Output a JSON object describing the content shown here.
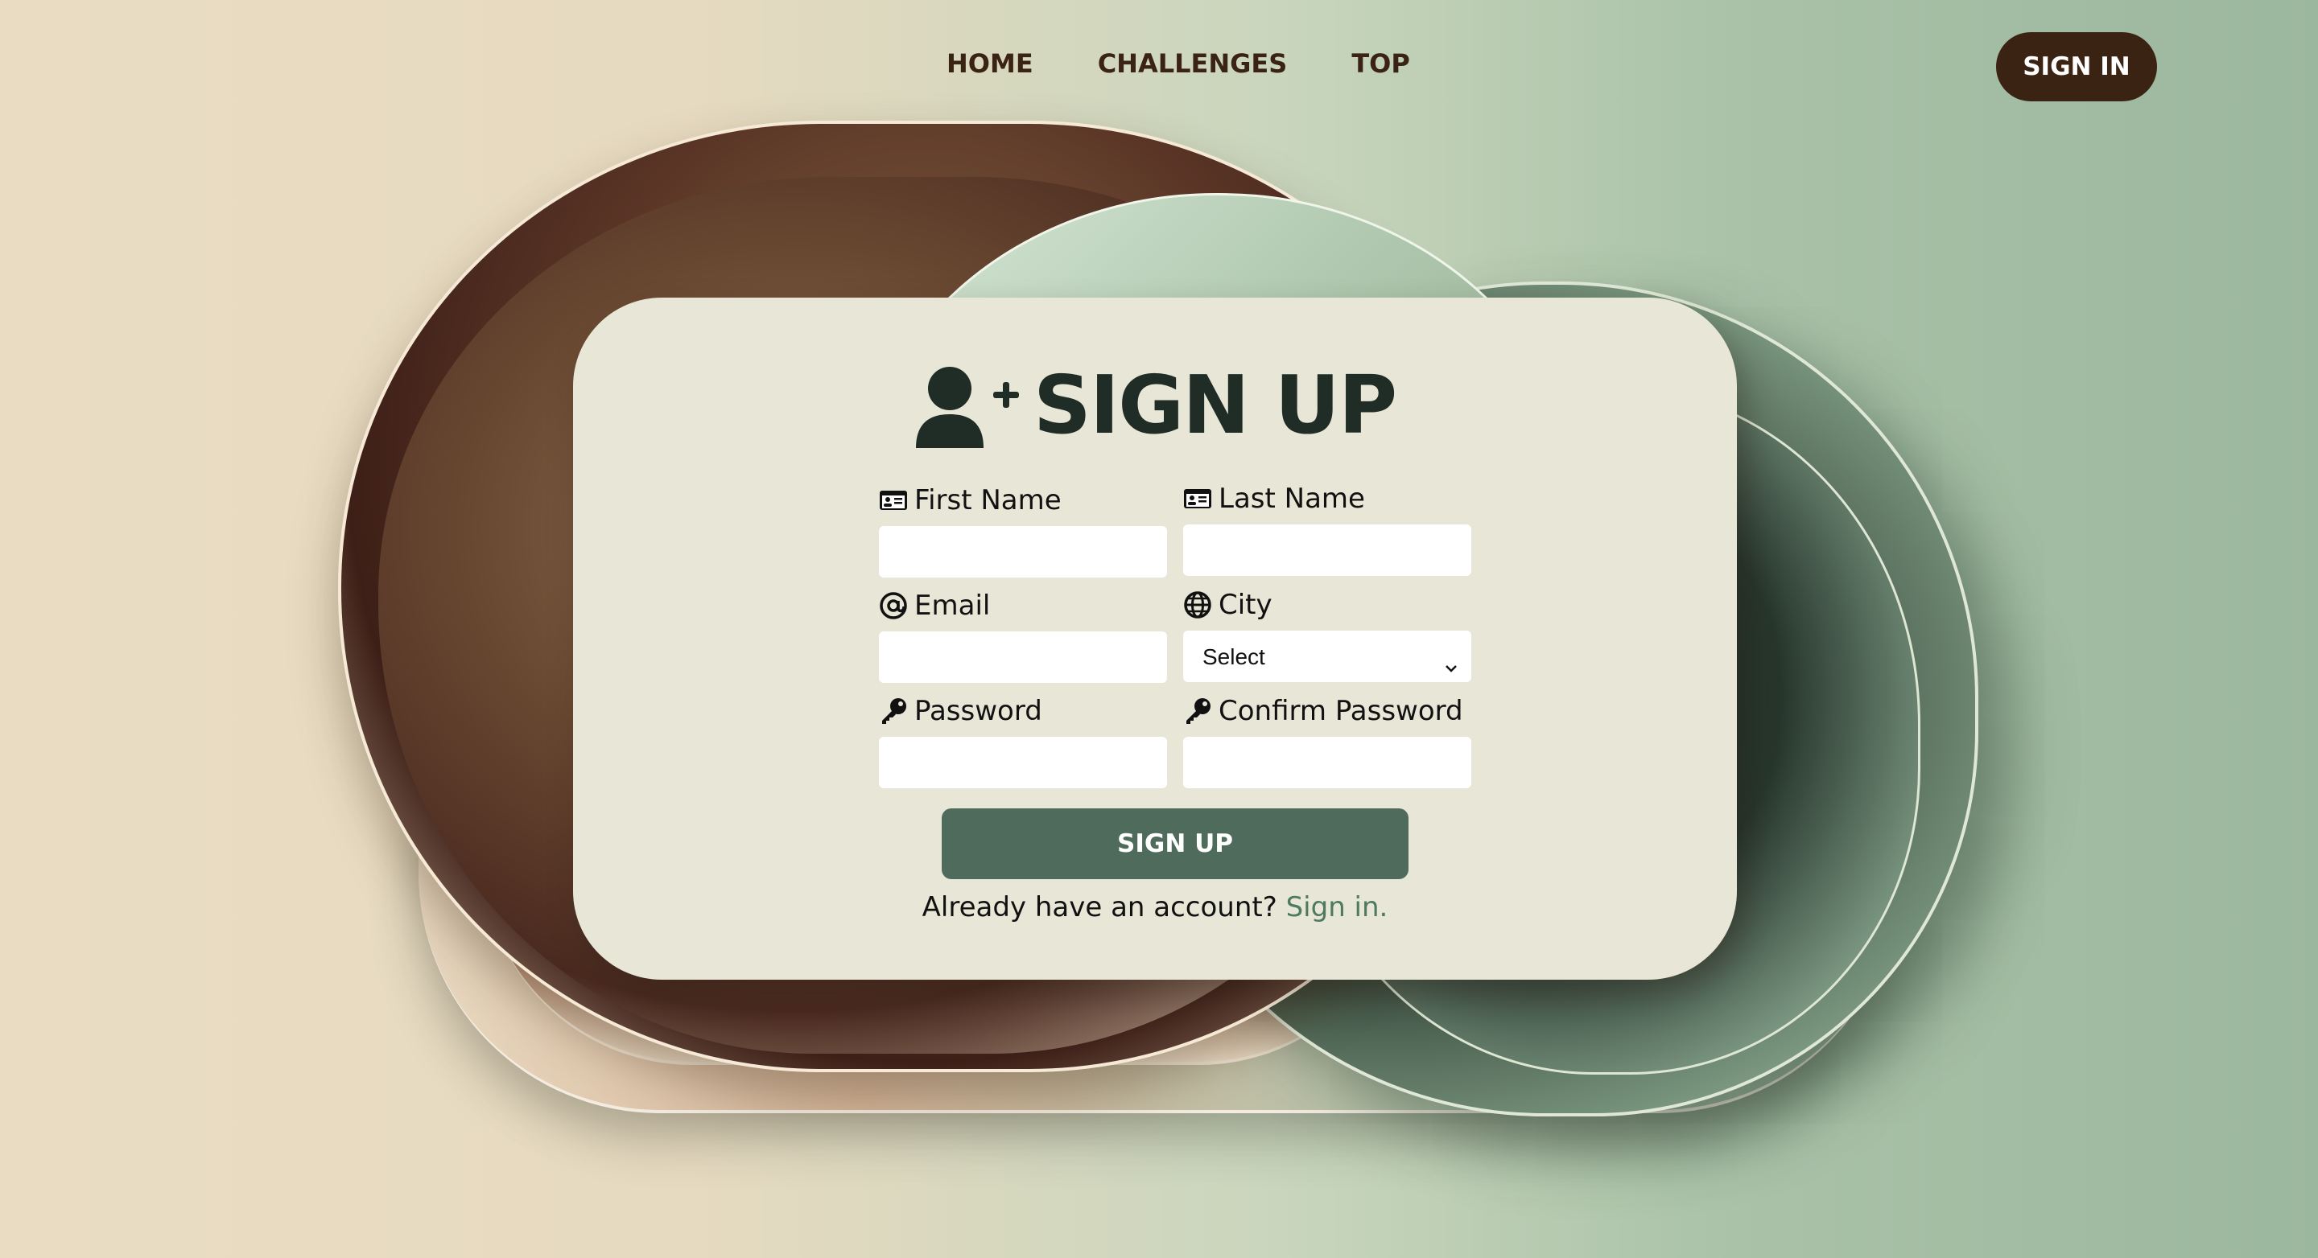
{
  "nav": {
    "links": [
      "HOME",
      "CHALLENGES",
      "TOP"
    ],
    "signin_label": "SIGN IN"
  },
  "card": {
    "title": "SIGN UP",
    "title_icon": "user-plus-icon",
    "fields": {
      "first_name": {
        "label": "First Name",
        "icon": "id-card-icon",
        "value": ""
      },
      "last_name": {
        "label": "Last Name",
        "icon": "id-card-icon",
        "value": ""
      },
      "email": {
        "label": "Email",
        "icon": "at-icon",
        "value": ""
      },
      "city": {
        "label": "City",
        "icon": "globe-icon",
        "selected": "Select"
      },
      "password": {
        "label": "Password",
        "icon": "key-icon",
        "value": ""
      },
      "confirm_password": {
        "label": "Confirm Password",
        "icon": "key-icon",
        "value": ""
      }
    },
    "submit_label": "SIGN UP",
    "footer_text": "Already have an account?",
    "footer_link": "Sign in."
  },
  "colors": {
    "nav_text": "#3b2313",
    "signin_bg": "#3b2313",
    "card_bg": "#e8e6d6",
    "submit_bg": "#4e6b5c",
    "link": "#4e7a5f",
    "title": "#1f2d26"
  }
}
